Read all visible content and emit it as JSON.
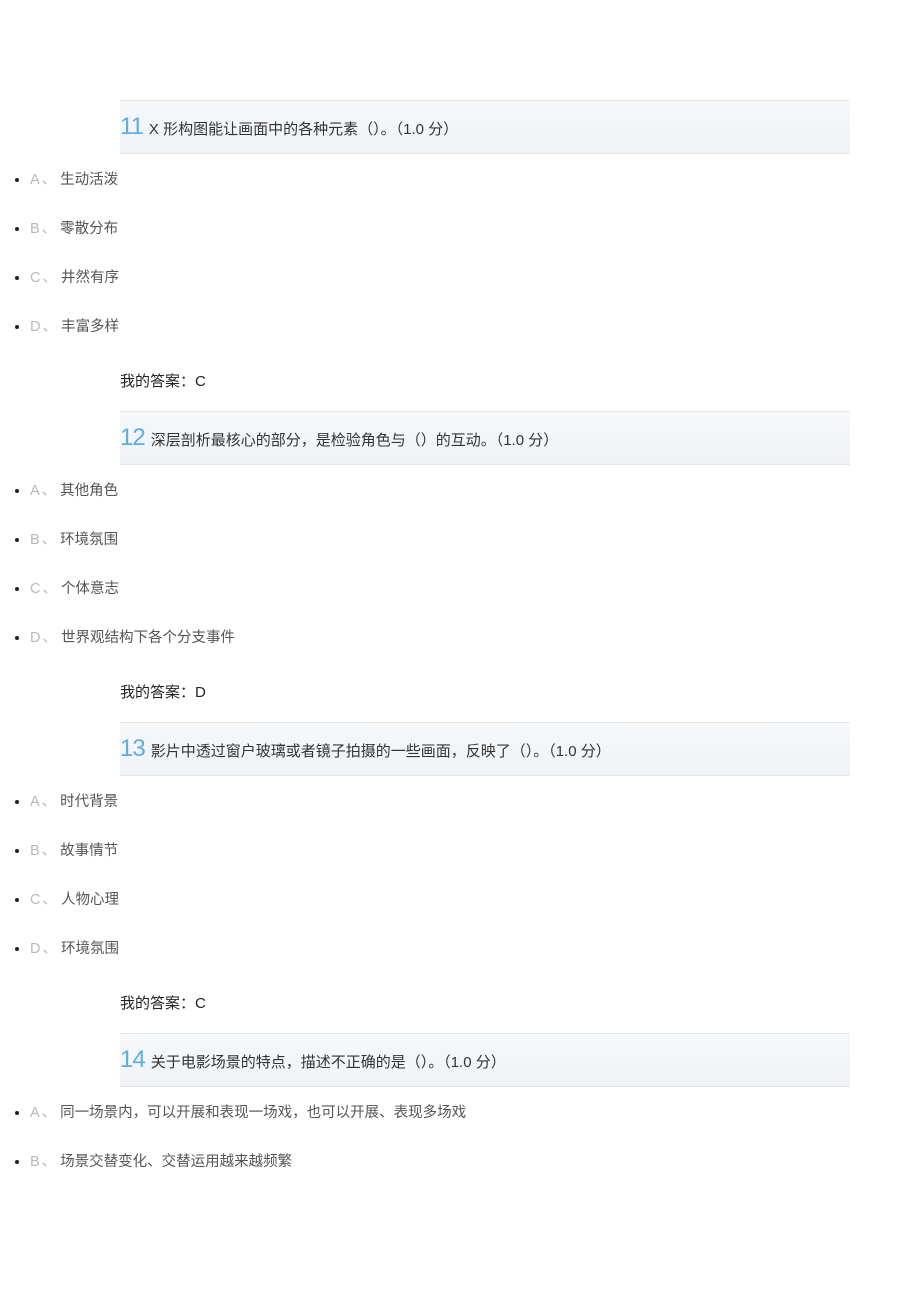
{
  "questions": [
    {
      "number": "11",
      "text": "X 形构图能让画面中的各种元素（）。（1.0 分）",
      "options": [
        {
          "letter": "A",
          "text": "生动活泼"
        },
        {
          "letter": "B",
          "text": "零散分布"
        },
        {
          "letter": "C",
          "text": "井然有序"
        },
        {
          "letter": "D",
          "text": "丰富多样"
        }
      ],
      "answer_label": "我的答案：",
      "answer_value": "C"
    },
    {
      "number": "12",
      "text": " 深层剖析最核心的部分，是检验角色与（）的互动。（1.0 分）",
      "options": [
        {
          "letter": "A",
          "text": "其他角色"
        },
        {
          "letter": "B",
          "text": "环境氛围"
        },
        {
          "letter": "C",
          "text": "个体意志"
        },
        {
          "letter": "D",
          "text": "世界观结构下各个分支事件"
        }
      ],
      "answer_label": "我的答案：",
      "answer_value": "D"
    },
    {
      "number": "13",
      "text": " 影片中透过窗户玻璃或者镜子拍摄的一些画面，反映了（）。（1.0 分）",
      "options": [
        {
          "letter": "A",
          "text": "时代背景"
        },
        {
          "letter": "B",
          "text": "故事情节"
        },
        {
          "letter": "C",
          "text": "人物心理"
        },
        {
          "letter": "D",
          "text": "环境氛围"
        }
      ],
      "answer_label": "我的答案：",
      "answer_value": "C"
    },
    {
      "number": "14",
      "text": " 关于电影场景的特点，描述不正确的是（）。（1.0 分）",
      "options": [
        {
          "letter": "A",
          "text": "同一场景内，可以开展和表现一场戏，也可以开展、表现多场戏"
        },
        {
          "letter": "B",
          "text": "场景交替变化、交替运用越来越频繁"
        }
      ],
      "answer_label": "",
      "answer_value": ""
    }
  ]
}
